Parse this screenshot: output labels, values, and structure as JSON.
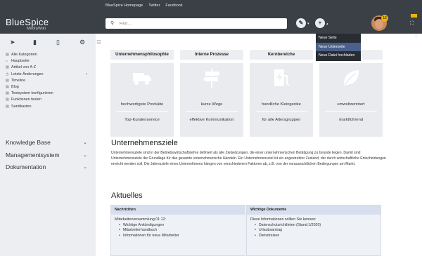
{
  "toplinks": [
    "BlueSpice Homepage",
    "Twitter",
    "Facebook"
  ],
  "header": {
    "logo": "BlueSpice",
    "logo_sub": "MediaWiki",
    "search_placeholder": "Find ...",
    "notification_count": "13"
  },
  "dropdown": {
    "items": [
      "Neue Seite",
      "Neue Unterseite",
      "Neue Datei hochladen"
    ],
    "active_index": 1
  },
  "sidebar": {
    "links": [
      {
        "icon": "list-icon",
        "label": "Alle Kategorien"
      },
      {
        "icon": "home-icon",
        "label": "Hauptseite"
      },
      {
        "icon": "list-icon",
        "label": "Artikel von A-Z"
      },
      {
        "icon": "clock-icon",
        "label": "Letzte Änderungen"
      },
      {
        "icon": "list-icon",
        "label": "Timeline"
      },
      {
        "icon": "list-icon",
        "label": "Blog"
      },
      {
        "icon": "list-icon",
        "label": "Testsystem konfigurieren"
      },
      {
        "icon": "list-icon",
        "label": "Funktionen testen"
      },
      {
        "icon": "list-icon",
        "label": "Sandkasten"
      }
    ],
    "groups": [
      "Knowledge Base",
      "Managementsystem",
      "Dokumentation"
    ]
  },
  "tabs": [
    "Unternehmensphilosophie",
    "Interne Prozesse",
    "Kernbereiche",
    ""
  ],
  "tiles": [
    {
      "icon": "truck-icon",
      "line1": "hochwertigste Produkte",
      "line2": "Top-Kundenservice"
    },
    {
      "icon": "signpost-icon",
      "line1": "kurze Wege",
      "line2": "effektive Kommunikation"
    },
    {
      "icon": "charging-station-icon",
      "line1": "handliche Kleingeräte",
      "line2": "für alle Altersgruppen"
    },
    {
      "icon": "leaf-icon",
      "line1": "umweltzentriert",
      "line2": "marktführend"
    }
  ],
  "section1": {
    "title": "Unternehmensziele",
    "text": "Unternehmensziele sind in der Betriebswirtschaftslehre definiert als alle Zielsetzungen, die einer unternehmerischen Betätigung zu Grunde liegen. Damit sind Unternehmensziele die Grundlage für das gesamte unternehmerische Handeln. Ein Unternehmensziel ist ein angestrebter Zustand, der durch wirtschaftliche Entscheidungen erreicht werden soll. Die Jahresziele eines Unternehmens hängen von verschiedenen Faktoren ab, z.B. von der voraussichtlichen Bedingungen am Markt."
  },
  "section2": {
    "title": "Aktuelles",
    "boxes": [
      {
        "header": "Nachrichten",
        "intro": "Mitarbeiterversammlung 01.12:",
        "items": [
          "Wichtige Ankündigungen",
          "Mitarbeiterhandbuch",
          "Informationen für neue Mitarbeiter"
        ]
      },
      {
        "header": "Wichtige Dokumente",
        "intro": "Diese Informationen sollten Sie kennen:",
        "items": [
          "Datenschutzrichtlinien (Stand:1/2020)",
          "Urlaubsantrag",
          "Dienstreisen"
        ]
      }
    ]
  },
  "colors": {
    "header_bg": "#3b4047",
    "sidebar_bg": "#eceef1",
    "dropdown_bg": "#282d33",
    "dropdown_active": "#4a5f8a",
    "badge": "#f0b400"
  }
}
